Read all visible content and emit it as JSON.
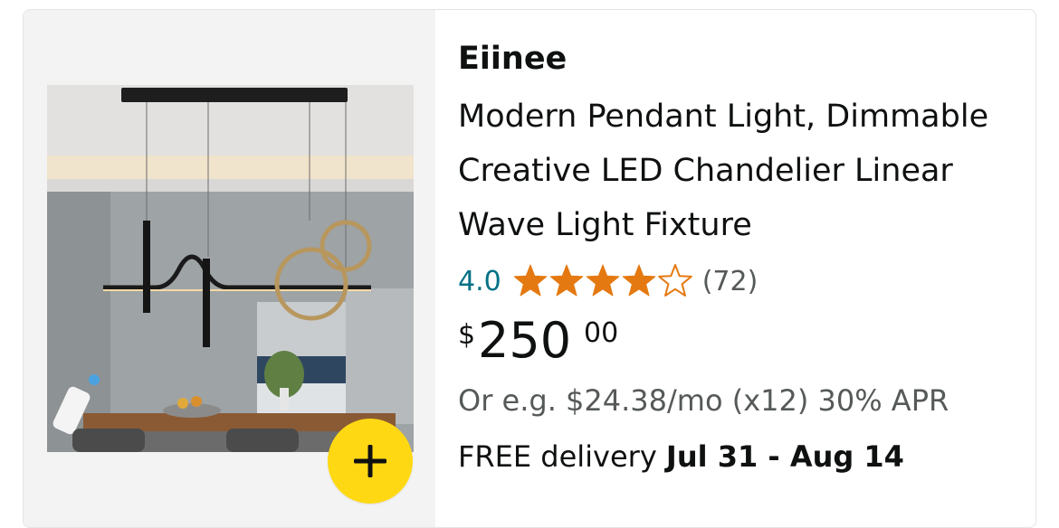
{
  "product": {
    "brand": "Eiinee",
    "title": "Modern Pendant Light, Dimmable Creative LED Chandelier Linear Wave Light Fixture",
    "rating": "4.0",
    "rating_value": 4.0,
    "rating_max": 5,
    "review_count": "(72)",
    "price": {
      "symbol": "$",
      "whole": "250",
      "fraction": "00"
    },
    "installment": "Or e.g. $24.38/mo (x12) 30% APR",
    "delivery": {
      "label": "FREE delivery",
      "dates": "Jul 31 - Aug 14"
    },
    "image_icon": "product-photo",
    "add_icon": "plus-icon"
  },
  "colors": {
    "rating_link": "#007185",
    "star": "#e47911",
    "add_button": "#ffd814",
    "muted_text": "#565959",
    "image_background": "#f3f3f3"
  }
}
